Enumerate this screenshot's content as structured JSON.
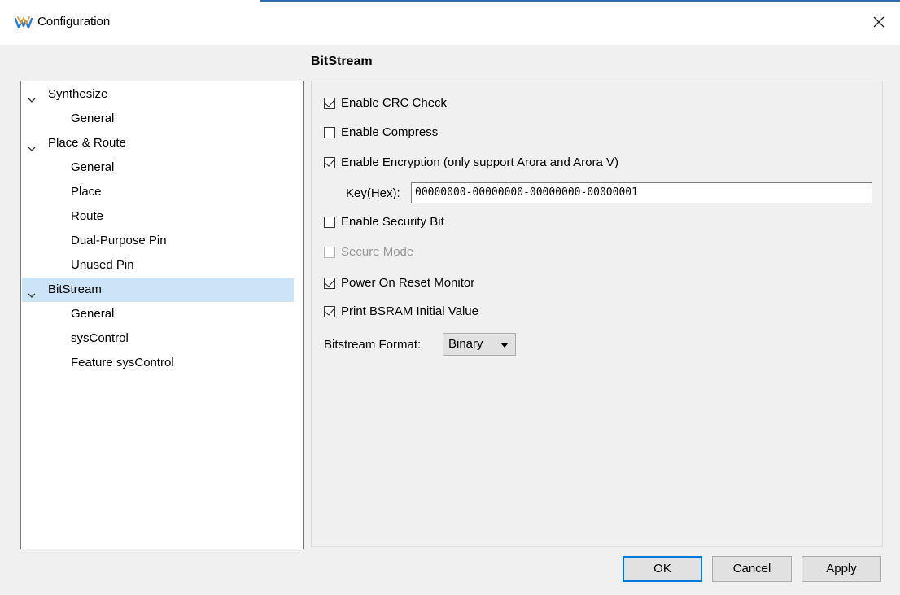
{
  "window": {
    "title": "Configuration",
    "icon": "gowin-logo-icon",
    "close_icon": "close-icon",
    "accent_color": "#2b6cb0"
  },
  "section_title": "BitStream",
  "tree": {
    "items": [
      {
        "label": "Synthesize",
        "level": 0,
        "expanded": true,
        "selected": false
      },
      {
        "label": "General",
        "level": 1,
        "selected": false
      },
      {
        "label": "Place & Route",
        "level": 0,
        "expanded": true,
        "selected": false
      },
      {
        "label": "General",
        "level": 1,
        "selected": false
      },
      {
        "label": "Place",
        "level": 1,
        "selected": false
      },
      {
        "label": "Route",
        "level": 1,
        "selected": false
      },
      {
        "label": "Dual-Purpose Pin",
        "level": 1,
        "selected": false
      },
      {
        "label": "Unused Pin",
        "level": 1,
        "selected": false
      },
      {
        "label": "BitStream",
        "level": 0,
        "expanded": true,
        "selected": true
      },
      {
        "label": "General",
        "level": 1,
        "selected": false
      },
      {
        "label": "sysControl",
        "level": 1,
        "selected": false
      },
      {
        "label": "Feature sysControl",
        "level": 1,
        "selected": false
      }
    ],
    "selected_color": "#cce4f7"
  },
  "options": {
    "crc_check": {
      "label": "Enable CRC Check",
      "checked": true
    },
    "compress": {
      "label": "Enable Compress",
      "checked": false
    },
    "encryption": {
      "label": "Enable Encryption (only support Arora and Arora V)",
      "checked": true
    },
    "key_label": "Key(Hex):",
    "key_value": "00000000-00000000-00000000-00000001",
    "security_bit": {
      "label": "Enable Security Bit",
      "checked": false
    },
    "secure_mode": {
      "label": "Secure Mode",
      "checked": false,
      "disabled": true
    },
    "power_on_reset": {
      "label": "Power On Reset Monitor",
      "checked": true
    },
    "print_bsram": {
      "label": "Print BSRAM Initial Value",
      "checked": true
    },
    "format_label": "Bitstream Format:",
    "format_value": "Binary"
  },
  "buttons": {
    "ok": "OK",
    "cancel": "Cancel",
    "apply": "Apply"
  }
}
